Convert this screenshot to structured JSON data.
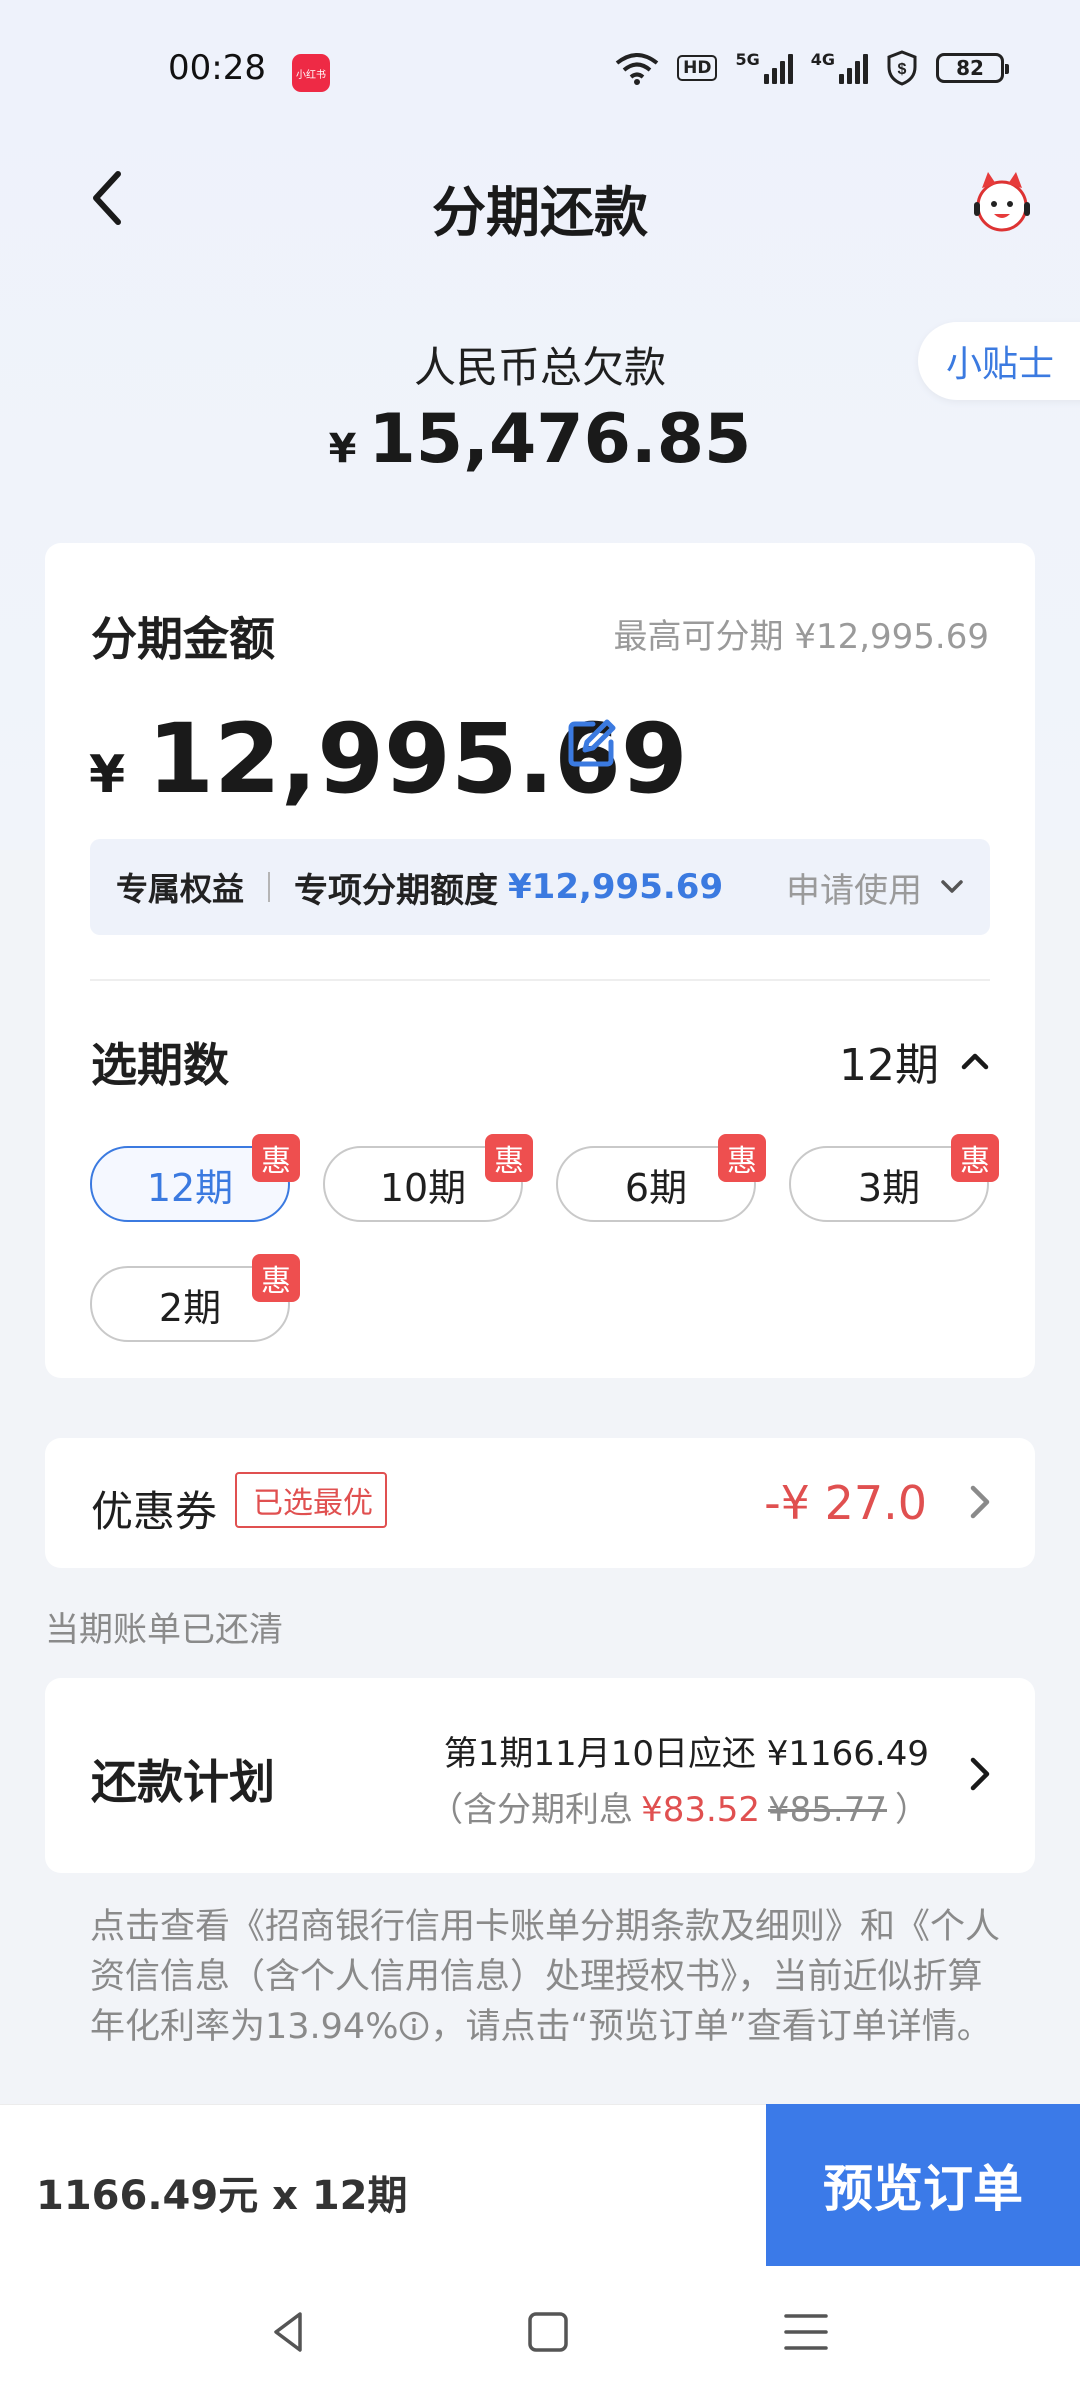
{
  "status_bar": {
    "time": "00:28",
    "app_icon_label": "小红书",
    "hd_label": "HD",
    "net_5g": "5G",
    "net_4g": "4G",
    "battery": "82"
  },
  "header": {
    "title": "分期还款",
    "tips_label": "小贴士"
  },
  "summary": {
    "debt_label": "人民币总欠款",
    "currency": "¥",
    "debt_amount": "15,476.85"
  },
  "amount_card": {
    "title": "分期金额",
    "max_text": "最高可分期 ¥12,995.69",
    "currency": "¥",
    "amount": "12,995.69",
    "benefit_tag": "专属权益",
    "benefit_text": "专项分期额度",
    "benefit_value": "¥12,995.69",
    "benefit_apply": "申请使用",
    "period_title": "选期数",
    "period_selected": "12期",
    "discount_badge": "惠",
    "periods": [
      {
        "label": "12期"
      },
      {
        "label": "10期"
      },
      {
        "label": "6期"
      },
      {
        "label": "3期"
      },
      {
        "label": "2期"
      }
    ]
  },
  "coupon": {
    "label": "优惠券",
    "tag": "已选最优",
    "value": "-¥ 27.0"
  },
  "bill_note": "当期账单已还清",
  "plan": {
    "title": "还款计划",
    "line1": "第1期11月10日应还 ¥1166.49",
    "line2_prefix": "（含分期利息",
    "interest_now": "¥83.52",
    "interest_old": "¥85.77",
    "line2_suffix": "）"
  },
  "terms": {
    "part1": "点击查看《招商银行信用卡账单分期条款及细则》和《个人资信信息（含个人信用信息）处理授权书》，当前近似折算年化利率为13.94%",
    "part2": "，请点击“预览订单”查看订单详情。"
  },
  "bottom": {
    "summary": "1166.49元 x 12期",
    "preview_button": "预览订单"
  },
  "colors": {
    "accent": "#3b7ae8",
    "discount_red": "#e05050",
    "badge_red": "#ee4f4f"
  },
  "icons": [
    "back-arrow-icon",
    "mascot-icon",
    "edit-icon",
    "chevron-down-icon",
    "chevron-up-icon",
    "chevron-right-icon",
    "info-icon",
    "nav-back-icon",
    "nav-home-icon",
    "nav-menu-icon"
  ]
}
